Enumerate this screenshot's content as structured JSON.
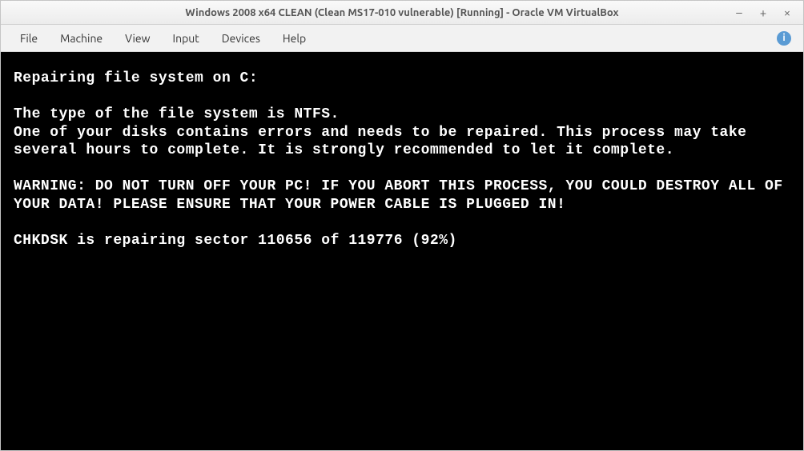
{
  "titlebar": {
    "title": "Windows 2008 x64 CLEAN (Clean MS17-010 vulnerable) [Running] - Oracle VM VirtualBox",
    "minimize": "–",
    "maximize": "+",
    "close": "×"
  },
  "menubar": {
    "items": [
      "File",
      "Machine",
      "View",
      "Input",
      "Devices",
      "Help"
    ],
    "info_glyph": "i"
  },
  "console": {
    "line1": "Repairing file system on C:",
    "blank1": "",
    "line2": "The type of the file system is NTFS.",
    "line3": "One of your disks contains errors and needs to be repaired. This process may take several hours to complete. It is strongly recommended to let it complete.",
    "blank2": "",
    "line4": "WARNING: DO NOT TURN OFF YOUR PC! IF YOU ABORT THIS PROCESS, YOU COULD DESTROY ALL OF YOUR DATA! PLEASE ENSURE THAT YOUR POWER CABLE IS PLUGGED IN!",
    "blank3": "",
    "line5_prefix": "CHKDSK is repairing sector ",
    "line5_current": "110656",
    "line5_of": " of ",
    "line5_total": "119776",
    "line5_pct_open": " (",
    "line5_pct": "92%",
    "line5_pct_close": ")"
  }
}
